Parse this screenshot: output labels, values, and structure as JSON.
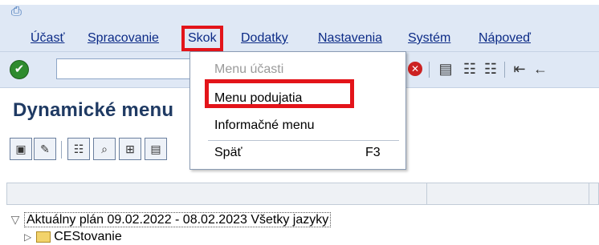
{
  "menubar": {
    "system_icon": "system-menu-icon",
    "items": [
      {
        "label": "Účasť"
      },
      {
        "label": "Spracovanie"
      },
      {
        "label": "Skok"
      },
      {
        "label": "Dodatky"
      },
      {
        "label": "Nastavenia"
      },
      {
        "label": "Systém"
      },
      {
        "label": "Nápoveď"
      }
    ]
  },
  "toolbar": {
    "command_field_value": "",
    "icons": [
      "enter-icon",
      "cancel-icon",
      "print-icon",
      "find-icon",
      "find-next-icon",
      "first-page-icon",
      "prev-page-icon"
    ]
  },
  "page": {
    "title": "Dynamické menu"
  },
  "dropdown": {
    "items": [
      {
        "label": "Menu účasti",
        "enabled": false
      },
      {
        "label": "Menu podujatia",
        "enabled": true
      },
      {
        "label": "Informačné menu",
        "enabled": true
      },
      {
        "label": "Späť",
        "shortcut": "F3",
        "enabled": true
      }
    ]
  },
  "tree": {
    "rows": [
      {
        "label": "Aktuálny plán 09.02.2022 - 08.02.2023 Všetky jazyky"
      },
      {
        "label": "CEStovanie"
      }
    ]
  },
  "colors": {
    "highlight": "#e3141a",
    "menubar_bg": "#dfe8f5",
    "menu_text": "#0b2a86",
    "title": "#1f3a63"
  }
}
